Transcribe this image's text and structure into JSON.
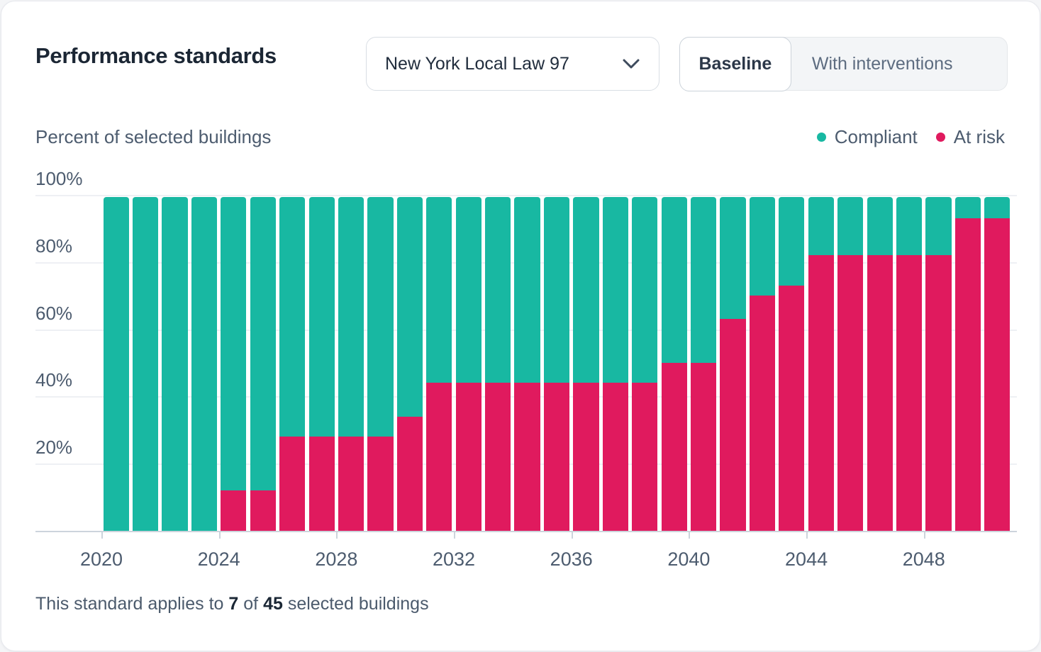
{
  "header": {
    "title": "Performance standards",
    "standard_select": {
      "value": "New York Local Law 97"
    },
    "scenario_toggle": {
      "options": [
        "Baseline",
        "With interventions"
      ],
      "active": "Baseline"
    }
  },
  "chart": {
    "axis_title": "Percent of selected buildings",
    "legend": [
      {
        "label": "Compliant",
        "color": "#18B8A2"
      },
      {
        "label": "At risk",
        "color": "#E01A5E"
      }
    ]
  },
  "chart_data": {
    "type": "bar",
    "stacked": true,
    "title": "Percent of selected buildings",
    "categories": [
      2020,
      2021,
      2022,
      2023,
      2024,
      2025,
      2026,
      2027,
      2028,
      2029,
      2030,
      2031,
      2032,
      2033,
      2034,
      2035,
      2036,
      2037,
      2038,
      2039,
      2040,
      2041,
      2042,
      2043,
      2044,
      2045,
      2046,
      2047,
      2048,
      2049,
      2050
    ],
    "series": [
      {
        "name": "Compliant",
        "color": "#18B8A2",
        "values": [
          100,
          100,
          100,
          100,
          88,
          88,
          72,
          72,
          72,
          72,
          66,
          56,
          56,
          56,
          56,
          56,
          56,
          56,
          56,
          50,
          50,
          37,
          30,
          27,
          18,
          18,
          18,
          18,
          18,
          7,
          7
        ]
      },
      {
        "name": "At risk",
        "color": "#E01A5E",
        "values": [
          0,
          0,
          0,
          0,
          12,
          12,
          28,
          28,
          28,
          28,
          34,
          44,
          44,
          44,
          44,
          44,
          44,
          44,
          44,
          50,
          50,
          63,
          70,
          73,
          82,
          82,
          82,
          82,
          82,
          93,
          93
        ]
      }
    ],
    "ylabel": "Percent of selected buildings",
    "xlabel": "",
    "ylim": [
      0,
      100
    ],
    "y_ticks": [
      {
        "value": 20,
        "label": "20%"
      },
      {
        "value": 40,
        "label": "40%"
      },
      {
        "value": 60,
        "label": "60%"
      },
      {
        "value": 80,
        "label": "80%"
      },
      {
        "value": 100,
        "label": "100%"
      }
    ],
    "x_ticks": [
      {
        "year": 2020,
        "label": "2020"
      },
      {
        "year": 2024,
        "label": "2024"
      },
      {
        "year": 2028,
        "label": "2028"
      },
      {
        "year": 2032,
        "label": "2032"
      },
      {
        "year": 2036,
        "label": "2036"
      },
      {
        "year": 2040,
        "label": "2040"
      },
      {
        "year": 2044,
        "label": "2044"
      },
      {
        "year": 2048,
        "label": "2048"
      }
    ],
    "legend_position": "top-right",
    "grid": true,
    "bar_top_rendered_percent": 99.3
  },
  "footer": {
    "prefix": "This standard applies to",
    "count": "7",
    "mid": "of",
    "total": "45",
    "suffix": "selected buildings"
  }
}
